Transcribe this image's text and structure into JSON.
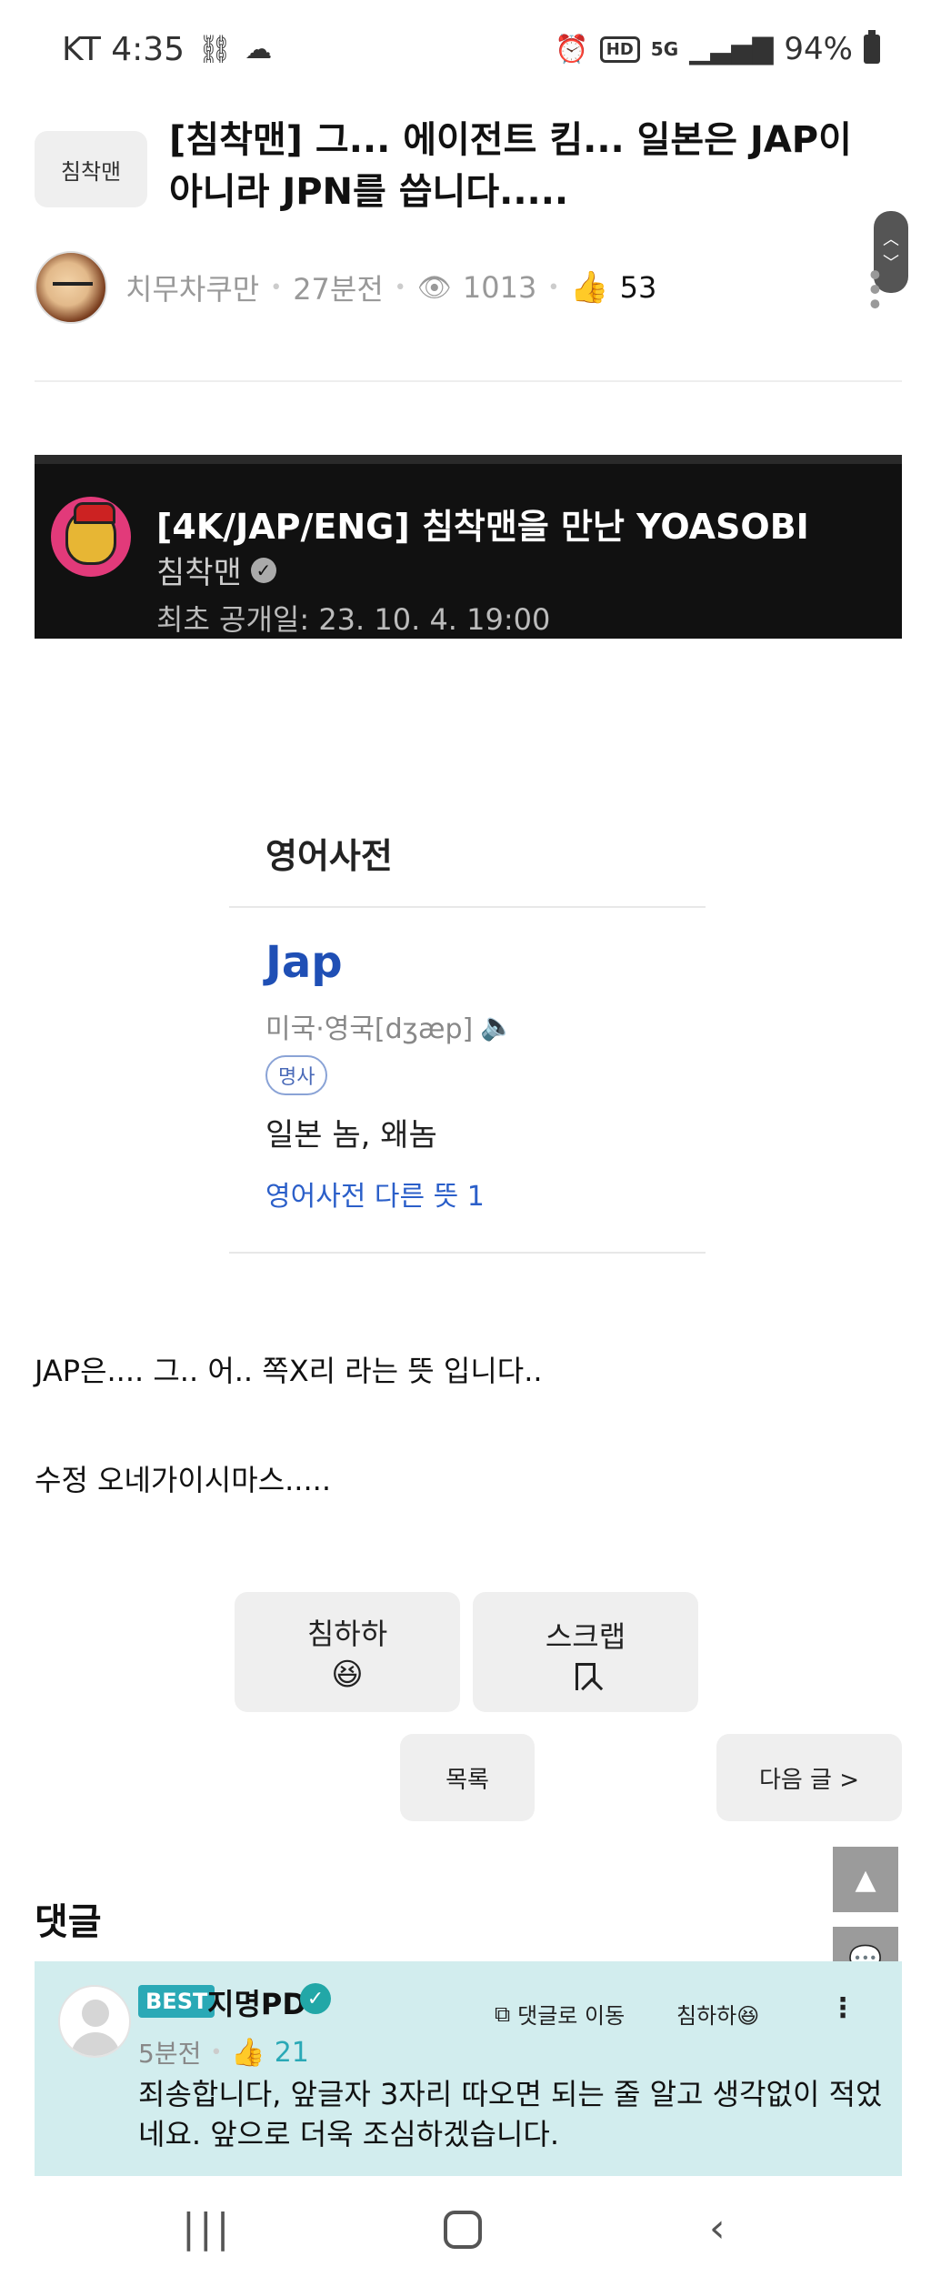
{
  "status_bar": {
    "carrier_time": "KT 4:35",
    "hd_label": "HD",
    "net_label": "5G",
    "battery": "94%"
  },
  "post": {
    "category": "침착맨",
    "title": "[침착맨] 그... 에이전트 킴... 일본은 JAP이 아니라 JPN를 씁니다.....",
    "author": "치무차쿠만",
    "time": "27분전",
    "views": "1013",
    "likes": "53"
  },
  "video": {
    "title": "[4K/JAP/ENG] 침착맨을 만난 YOASOBI",
    "channel": "침착맨",
    "premiere": "최초 공개일: 23. 10. 4. 19:00"
  },
  "dictionary": {
    "heading": "영어사전",
    "word": "Jap",
    "pronunciation": "미국·영국[dʒæp]",
    "pos": "명사",
    "meaning": "일본 놈, 왜놈",
    "more_link": "영어사전 다른 뜻 1"
  },
  "body": {
    "line1": "JAP은.... 그.. 어.. 쪽X리 라는 뜻 입니다..",
    "line2": "수정 오네가이시마스....."
  },
  "actions": {
    "react_label": "침하하",
    "react_emoji": "😆",
    "scrap_label": "스크랩",
    "list_label": "목록",
    "next_label": "다음 글 >"
  },
  "comments": {
    "title": "댓글",
    "items": [
      {
        "badge": "BEST",
        "author": "지명PD",
        "time": "5분전",
        "likes": "21",
        "goto_label": "댓글로 이동",
        "react_label": "침하하😆",
        "text": "죄송합니다, 앞글자 3자리 따오면 되는 줄 알고 생각없이 적었네요. 앞으로 더욱 조심하겠습니다."
      }
    ]
  },
  "icons": {
    "status": [
      "link-icon",
      "cloud-icon",
      "alarm-icon",
      "signal-icon",
      "battery-icon"
    ],
    "floating": [
      "arrow-up-icon",
      "chat-icon",
      "arrow-down-icon"
    ],
    "nav": [
      "recent-apps-icon",
      "home-icon",
      "back-icon"
    ]
  },
  "colors": {
    "comment_bg": "#d2edee",
    "best_badge": "#2aa9b6",
    "dict_word": "#1f4fb5",
    "dict_link": "#2b5fc9"
  }
}
